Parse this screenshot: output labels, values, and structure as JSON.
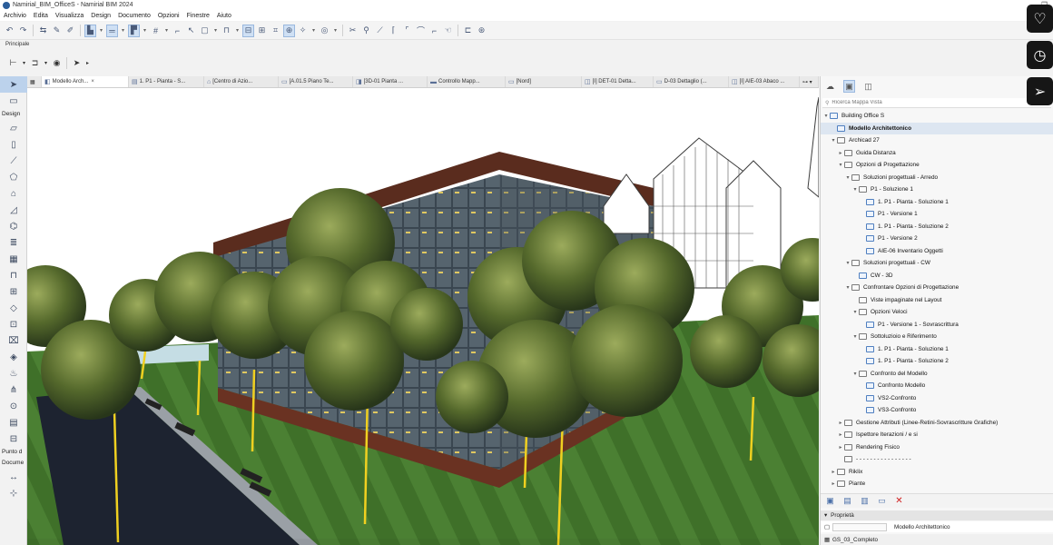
{
  "window": {
    "title": "Namirial_BIM_OfficeS - Namirial BIM 2024"
  },
  "menu": [
    "Archivio",
    "Edita",
    "Visualizza",
    "Design",
    "Documento",
    "Opzioni",
    "Finestre",
    "Aiuto"
  ],
  "toolbar_label": "Principale",
  "palette": {
    "design_label": "Design",
    "punto_label": "Punto d",
    "docume_label": "Docume"
  },
  "tabs": [
    {
      "label": "Modello Arch...",
      "active": true
    },
    {
      "label": "1. P1 - Pianta - S..."
    },
    {
      "label": "[Centro di Azio..."
    },
    {
      "label": "[A.01.5 Piano Te..."
    },
    {
      "label": "[3D-01 Pianta ..."
    },
    {
      "label": "Controllo Mapp..."
    },
    {
      "label": "[Nord]"
    },
    {
      "label": "[I] DET-01 Detta..."
    },
    {
      "label": "D-03 Dettaglio (..."
    },
    {
      "label": "[I] AIE-03 Abaco ..."
    }
  ],
  "navigator": {
    "search_placeholder": "Ricerca Mappa Vista",
    "tree": [
      {
        "label": "Building Office S",
        "level": 0,
        "caret": "v",
        "icon": "view"
      },
      {
        "label": "Modello Architettonico",
        "level": 1,
        "caret": "",
        "icon": "view",
        "selected": true
      },
      {
        "label": "Archicad 27",
        "level": 1,
        "caret": "v",
        "icon": "fold"
      },
      {
        "label": "Guida Distanza",
        "level": 2,
        "caret": ">",
        "icon": "fold"
      },
      {
        "label": "Opzioni di Progettazione",
        "level": 2,
        "caret": "v",
        "icon": "fold"
      },
      {
        "label": "Soluzioni progettuali - Arredo",
        "level": 3,
        "caret": "v",
        "icon": "fold"
      },
      {
        "label": "P1 - Soluzione 1",
        "level": 4,
        "caret": "v",
        "icon": "fold"
      },
      {
        "label": "1. P1 - Pianta - Soluzione 1",
        "level": 5,
        "caret": "",
        "icon": "view"
      },
      {
        "label": "P1 - Versione 1",
        "level": 5,
        "caret": "",
        "icon": "view"
      },
      {
        "label": "1. P1 - Pianta - Soluzione 2",
        "level": 5,
        "caret": "",
        "icon": "view"
      },
      {
        "label": "P1 - Versione 2",
        "level": 5,
        "caret": "",
        "icon": "view"
      },
      {
        "label": "AIE-06 Inventario Oggetti",
        "level": 5,
        "caret": "",
        "icon": "view"
      },
      {
        "label": "Soluzioni progettuali - CW",
        "level": 3,
        "caret": "v",
        "icon": "fold"
      },
      {
        "label": "CW - 3D",
        "level": 4,
        "caret": "",
        "icon": "view"
      },
      {
        "label": "Confrontare Opzioni di Progettazione",
        "level": 3,
        "caret": "v",
        "icon": "fold"
      },
      {
        "label": "Viste impaginate nel Layout",
        "level": 4,
        "caret": "",
        "icon": "fold"
      },
      {
        "label": "Opzioni Veloci",
        "level": 4,
        "caret": "v",
        "icon": "fold"
      },
      {
        "label": "P1 - Versione 1 - Sovrascrittura",
        "level": 5,
        "caret": "",
        "icon": "view"
      },
      {
        "label": "Sottoluzioio e Riferimento",
        "level": 4,
        "caret": "v",
        "icon": "fold"
      },
      {
        "label": "1. P1 - Pianta - Soluzione 1",
        "level": 5,
        "caret": "",
        "icon": "view"
      },
      {
        "label": "1. P1 - Pianta - Soluzione 2",
        "level": 5,
        "caret": "",
        "icon": "view"
      },
      {
        "label": "Confronto del Modello",
        "level": 4,
        "caret": "v",
        "icon": "fold"
      },
      {
        "label": "Confronto Modello",
        "level": 5,
        "caret": "",
        "icon": "view"
      },
      {
        "label": "VS2-Confronto",
        "level": 5,
        "caret": "",
        "icon": "view"
      },
      {
        "label": "VS3-Confronto",
        "level": 5,
        "caret": "",
        "icon": "view"
      },
      {
        "label": "Gestione Attributi (Linee-Retini-Sovrascritture Grafiche)",
        "level": 2,
        "caret": ">",
        "icon": "fold"
      },
      {
        "label": "Ispettore Iterazioni / e si",
        "level": 2,
        "caret": ">",
        "icon": "fold"
      },
      {
        "label": "Rendering Fisico",
        "level": 2,
        "caret": ">",
        "icon": "fold"
      },
      {
        "label": "- - - - - - - - - - - - - - - -",
        "level": 2,
        "caret": "",
        "icon": "fold"
      },
      {
        "label": "Riklix",
        "level": 1,
        "caret": ">",
        "icon": "fold"
      },
      {
        "label": "Piante",
        "level": 1,
        "caret": ">",
        "icon": "fold"
      }
    ],
    "properties_header": "Proprietà",
    "properties_value": "Modello Architettonico",
    "status": "GS_03_Completo"
  }
}
